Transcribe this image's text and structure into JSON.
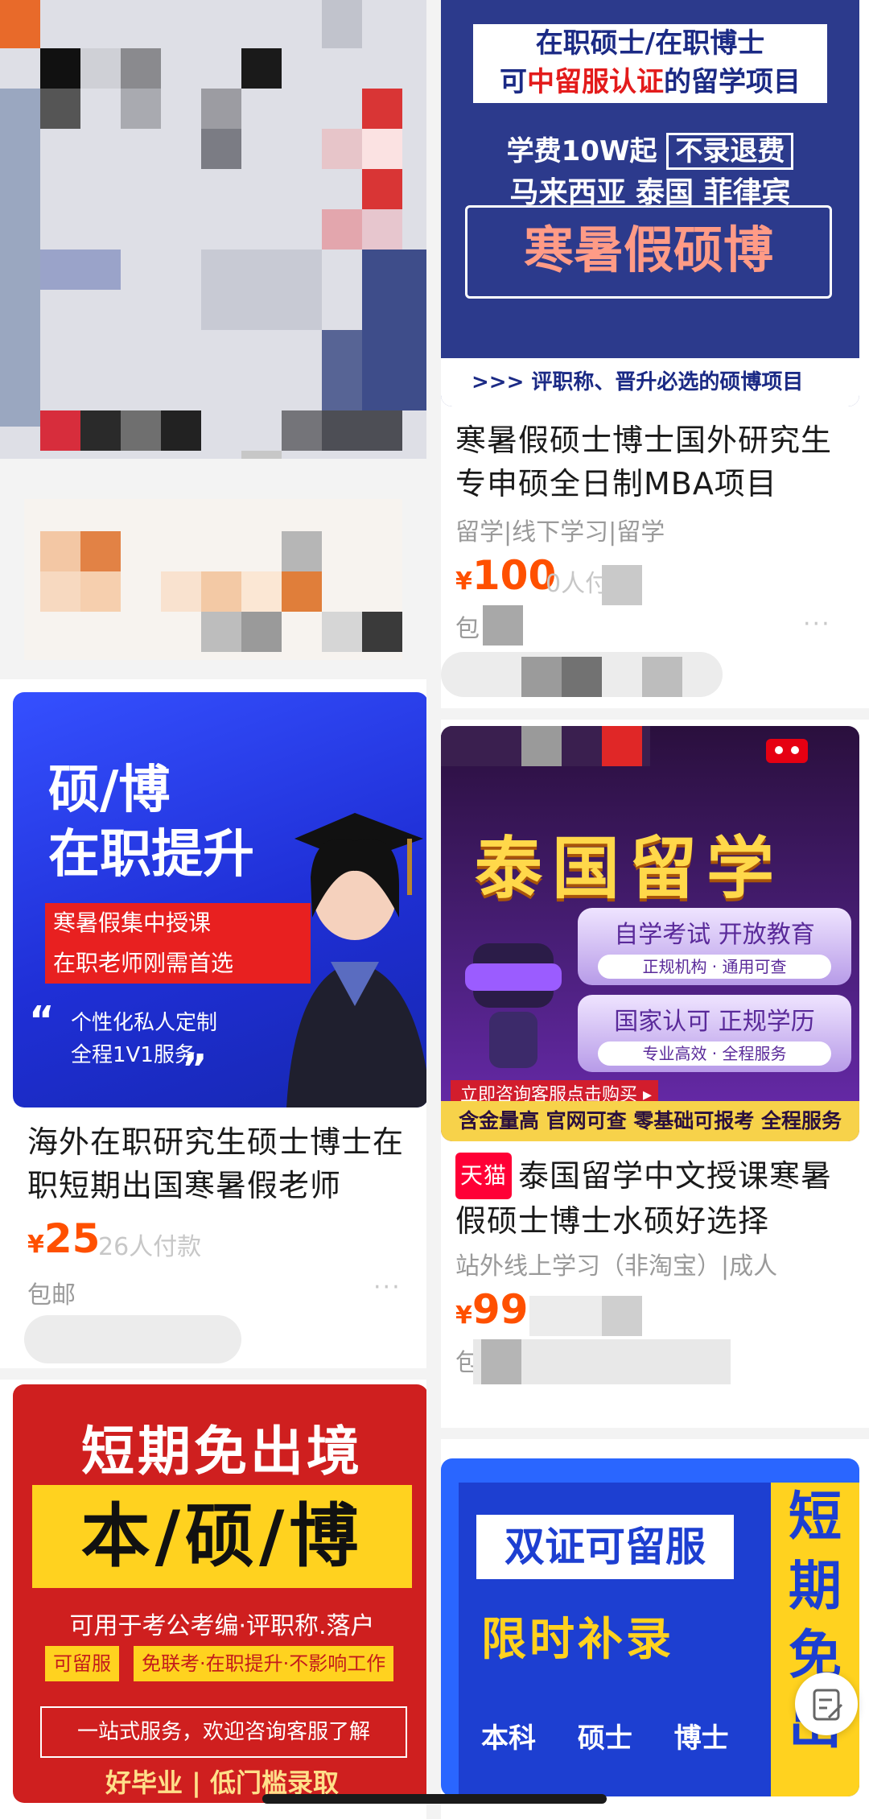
{
  "products": [
    {
      "id": "A",
      "image_text": {
        "line1": "在职硕士/在职博士",
        "line2_prefix": "可",
        "line2_highlight": "中留服认证",
        "line2_suffix": "的留学项目",
        "fee": "学费10W起",
        "fee_tag": "不录退费",
        "countries": "马来西亚 泰国 菲律宾",
        "headline": "寒暑假硕博",
        "footer": ">>>  评职称、晋升必选的硕博项目"
      },
      "title": "寒暑假硕士博士国外研究生专申硕全日制MBA项目",
      "tags": "留学|线下学习|留学",
      "price_symbol": "¥",
      "price": "100",
      "sales": "0人付款",
      "shipping": "包",
      "more": "···"
    },
    {
      "id": "B",
      "image_text": {
        "line1": "硕/博",
        "line2": "在职提升",
        "red1": "寒暑假集中授课",
        "red2": "在职老师刚需首选",
        "quote_open": "“",
        "quote_close": "”",
        "s1": "个性化私人定制",
        "s2": "全程1V1服务"
      },
      "title": "海外在职研究生硕士博士在职短期出国寒暑假老师",
      "price_symbol": "¥",
      "price": "25",
      "sales": "26人付款",
      "shipping": "包邮",
      "more": "···"
    },
    {
      "id": "C",
      "image_text": {
        "title": "泰国留学",
        "p1a": "自学考试 开放教育",
        "p1b": "正规机构 · 通用可查",
        "p2a": "国家认可 正规学历",
        "p2b": "专业高效 · 全程服务",
        "cta": "立即咨询客服点击购买 ▸",
        "footer": "含金量高 官网可查 零基础可报考 全程服务"
      },
      "badge": "天猫",
      "title": "泰国留学中文授课寒暑假硕士博士水硕好选择",
      "tags": "站外线上学习（非淘宝）|成人",
      "price_symbol": "¥",
      "price": "99",
      "shipping": "包"
    },
    {
      "id": "D",
      "image_text": {
        "t1": "短期免出境",
        "t2": "本/硕/博",
        "sub": "可用于考公考编·评职称.落户",
        "chip1": "可留服",
        "chip2": "免联考·在职提升·不影响工作",
        "box": "一站式服务，欢迎咨询客服了解",
        "t3": "好毕业 | 低门槛录取"
      }
    },
    {
      "id": "E",
      "image_text": {
        "w1": "双证可留服",
        "w2": "限时补录",
        "w3": "本科 硕士 博士",
        "side": "短期免出"
      }
    }
  ],
  "floating_button": {
    "icon": "edit-note-icon"
  },
  "colors": {
    "price": "#ff5000",
    "badge": "#ff0036",
    "background": "#f3f3f3"
  }
}
